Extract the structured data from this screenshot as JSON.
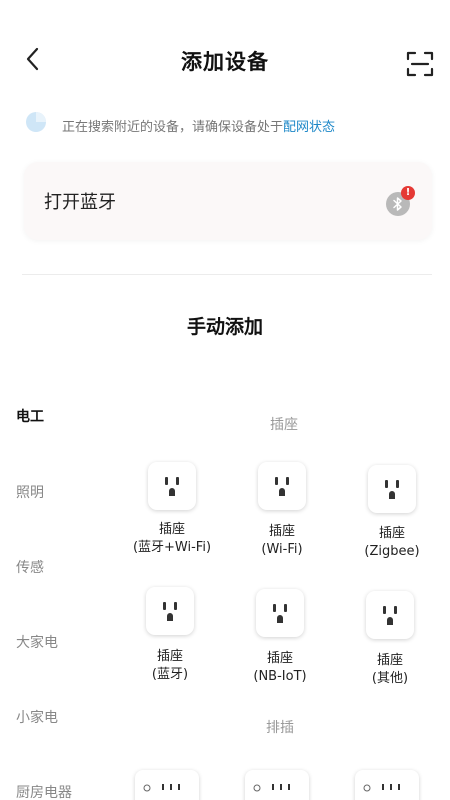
{
  "header": {
    "title": "添加设备",
    "back_icon": "chevron-left-icon",
    "scan_icon": "scan-icon"
  },
  "search_hint": {
    "text": "正在搜索附近的设备，请确保设备处于",
    "link": "配网状态"
  },
  "bluetooth": {
    "label": "打开蓝牙",
    "alert": "!"
  },
  "manual_add": {
    "title": "手动添加"
  },
  "categories": [
    {
      "label": "电工",
      "active": true
    },
    {
      "label": "照明",
      "active": false
    },
    {
      "label": "传感",
      "active": false
    },
    {
      "label": "大家电",
      "active": false
    },
    {
      "label": "小家电",
      "active": false
    },
    {
      "label": "厨房电器",
      "active": false
    }
  ],
  "groups": [
    {
      "title": "插座",
      "devices": [
        {
          "line1": "插座",
          "line2": "(蓝牙+Wi-Fi)"
        },
        {
          "line1": "插座",
          "line2": "(Wi-Fi)"
        },
        {
          "line1": "插座",
          "line2": "(Zigbee)"
        },
        {
          "line1": "插座",
          "line2": "(蓝牙)"
        },
        {
          "line1": "插座",
          "line2": "(NB-IoT)"
        },
        {
          "line1": "插座",
          "line2": "(其他)"
        }
      ]
    },
    {
      "title": "排插"
    }
  ]
}
